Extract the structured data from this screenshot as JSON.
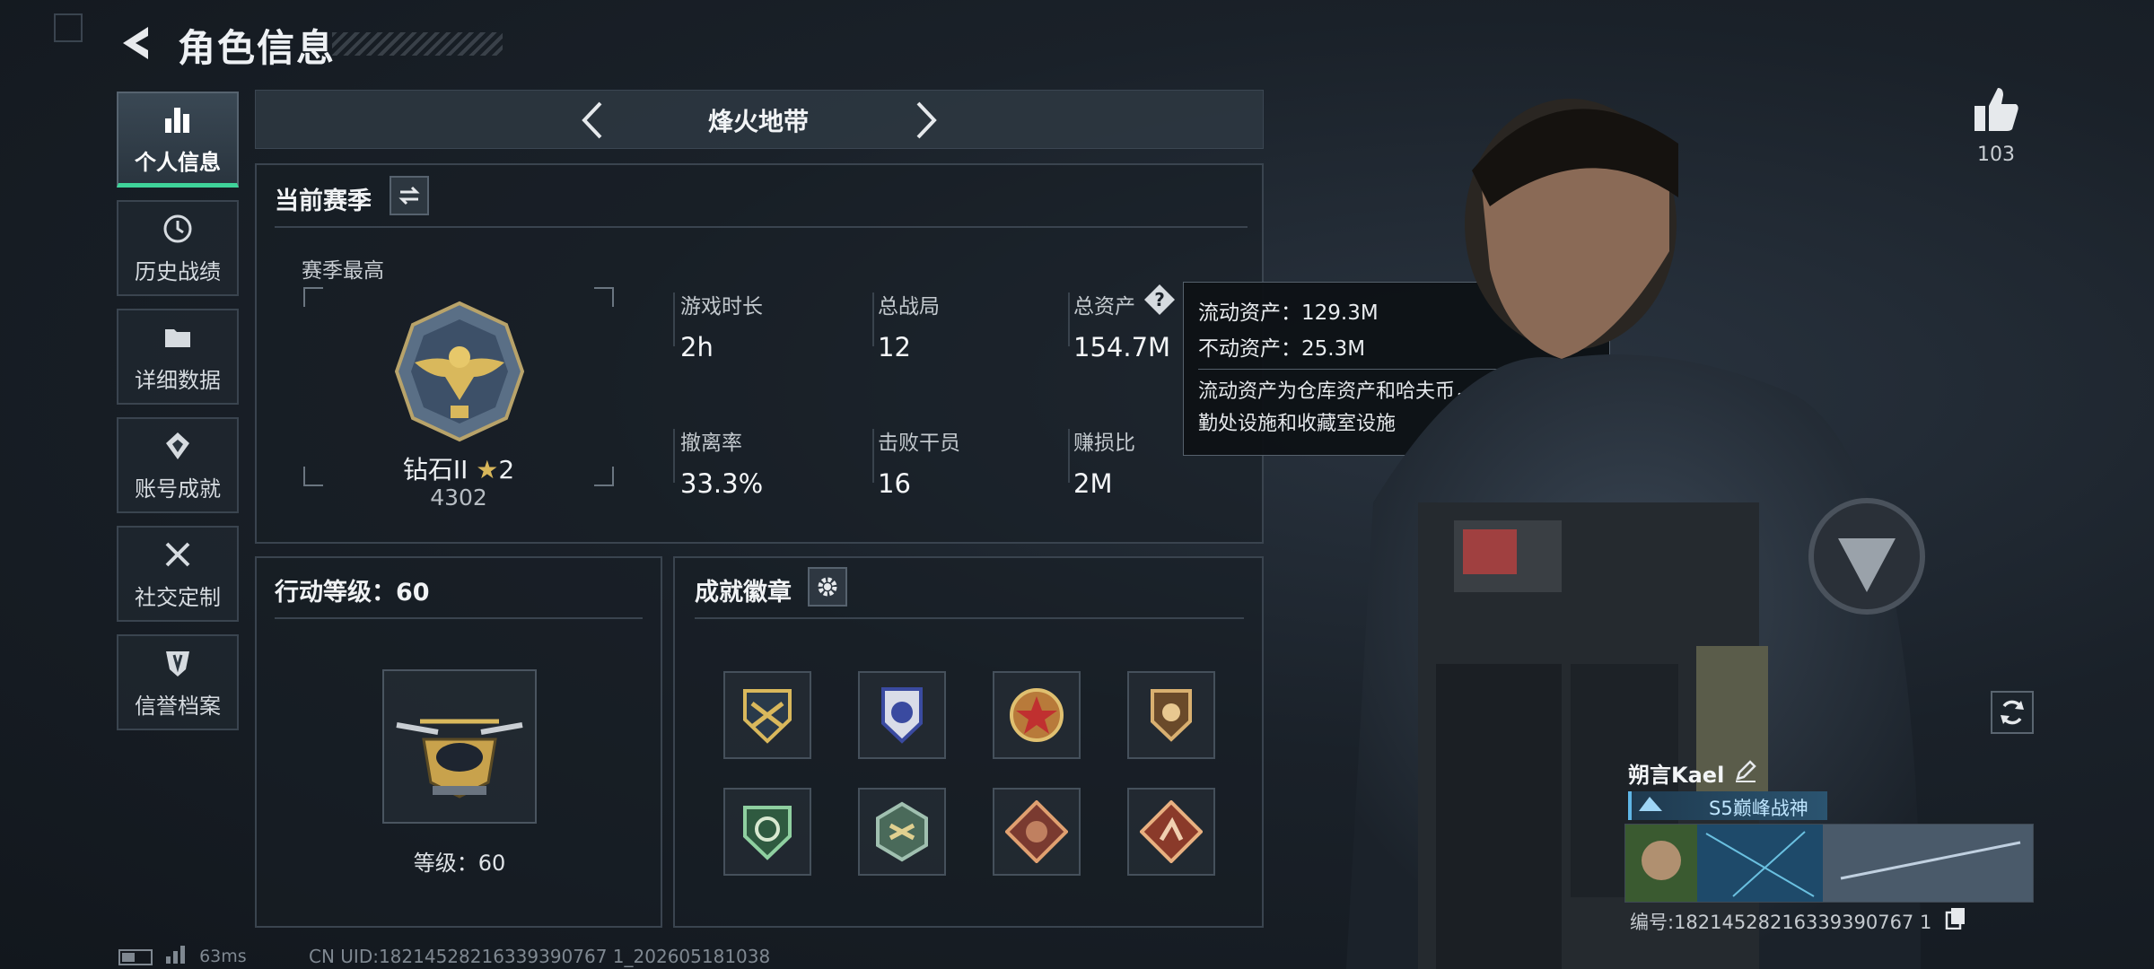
{
  "header": {
    "title": "角色信息",
    "back_icon": "back-arrow-icon"
  },
  "nav": {
    "items": [
      {
        "label": "个人信息",
        "icon": "bar-chart-icon",
        "active": true
      },
      {
        "label": "历史战绩",
        "icon": "clock-icon",
        "active": false
      },
      {
        "label": "详细数据",
        "icon": "folder-icon",
        "active": false
      },
      {
        "label": "账号成就",
        "icon": "medal-icon",
        "active": false
      },
      {
        "label": "社交定制",
        "icon": "wrench-icon",
        "active": false
      },
      {
        "label": "信誉档案",
        "icon": "shield-icon",
        "active": false
      }
    ]
  },
  "mode": {
    "label": "烽火地带"
  },
  "season": {
    "title": "当前赛季",
    "best_label": "赛季最高",
    "rank_name": "钻石II",
    "rank_stars": "2",
    "rank_score": "4302",
    "stats": [
      {
        "label": "游戏时长",
        "value": "2h"
      },
      {
        "label": "总战局",
        "value": "12"
      },
      {
        "label": "总资产",
        "value": "154.7M"
      },
      {
        "label": "撤离率",
        "value": "33.3%"
      },
      {
        "label": "击败干员",
        "value": "16"
      },
      {
        "label": "赚损比",
        "value": "2M"
      }
    ]
  },
  "tooltip": {
    "liquid": "流动资产：129.3M",
    "fixed": "不动资产：25.3M",
    "desc": "流动资产为仓库资产和哈夫币，不动资产为特勤处设施和收藏室设施"
  },
  "level": {
    "title": "行动等级：60",
    "caption": "等级：60"
  },
  "badges": {
    "title": "成就徽章",
    "items": [
      "badge-1-icon",
      "badge-2-icon",
      "badge-3-icon",
      "badge-4-icon",
      "badge-5-icon",
      "badge-6-icon",
      "badge-7-icon",
      "badge-8-icon"
    ]
  },
  "profile": {
    "likes": "103",
    "name": "朔言Kael",
    "title_badge": "S5巅峰战神",
    "uid_line": "编号:18214528216339390767 1"
  },
  "status": {
    "ping": "63ms",
    "uid": "CN UID:18214528216339390767 1_202605181038"
  },
  "colors": {
    "accent_green": "#3fd39a",
    "panel_border": "#3a444f"
  }
}
